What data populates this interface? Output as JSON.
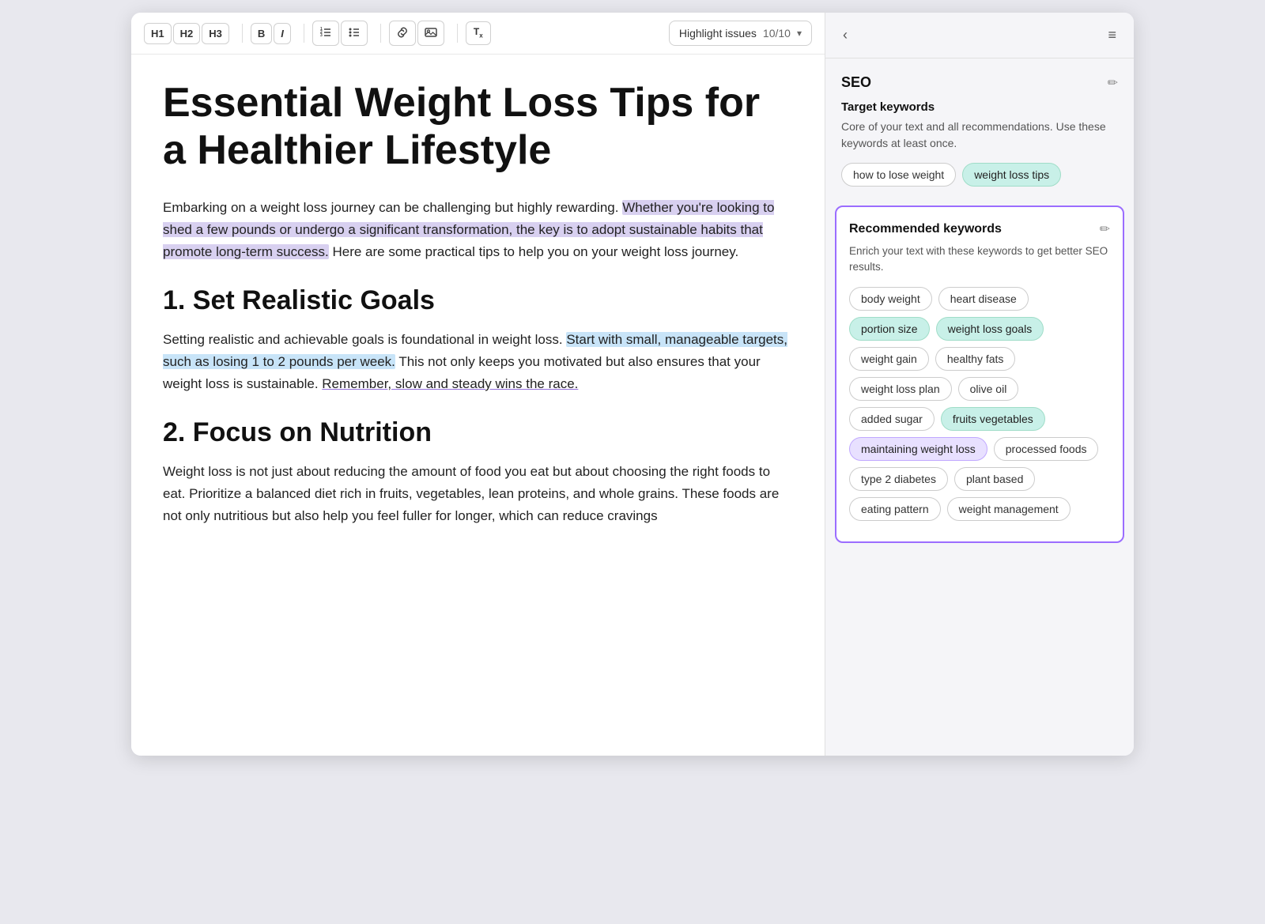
{
  "toolbar": {
    "h1_label": "H1",
    "h2_label": "H2",
    "h3_label": "H3",
    "bold_label": "B",
    "italic_label": "I",
    "highlight_label": "Highlight issues",
    "highlight_count": "10/10"
  },
  "editor": {
    "title": "Essential Weight Loss Tips for a Healthier Lifestyle",
    "paragraph1_plain": "Embarking on a weight loss journey can be challenging but highly rewarding. ",
    "paragraph1_highlight": "Whether you're looking to shed a few pounds or undergo a significant transformation, the key is to adopt sustainable habits that promote long-term success.",
    "paragraph1_end": " Here are some practical tips to help you on your weight loss journey.",
    "heading1": "1. Set Realistic Goals",
    "paragraph2_plain": "Setting realistic and achievable goals is foundational in weight loss. ",
    "paragraph2_highlight": "Start with small, manageable targets, such as losing 1 to 2 pounds per week.",
    "paragraph2_mid": " This not only keeps you motivated but also ensures that your weight loss is sustainable. ",
    "paragraph2_underline": "Remember, slow and steady wins the race.",
    "heading2": "2. Focus on Nutrition",
    "paragraph3": "Weight loss is not just about reducing the amount of food you eat but about choosing the right foods to eat. Prioritize a balanced diet rich in fruits, vegetables, lean proteins, and whole grains. These foods are not only nutritious but also help you feel fuller for longer, which can reduce cravings"
  },
  "seo_panel": {
    "title": "SEO",
    "back_icon": "‹",
    "menu_icon": "≡",
    "edit_icon": "✏",
    "target_keywords": {
      "label": "Target keywords",
      "description": "Core of your text and all recommendations. Use these keywords at least once.",
      "keywords": [
        {
          "text": "how to lose weight",
          "style": "default"
        },
        {
          "text": "weight loss tips",
          "style": "active-teal"
        }
      ]
    },
    "recommended_keywords": {
      "label": "Recommended keywords",
      "description": "Enrich your text with these keywords to get better SEO results.",
      "keywords": [
        {
          "text": "body weight",
          "style": "default"
        },
        {
          "text": "heart disease",
          "style": "default"
        },
        {
          "text": "portion size",
          "style": "active-teal"
        },
        {
          "text": "weight loss goals",
          "style": "active-teal"
        },
        {
          "text": "weight gain",
          "style": "default"
        },
        {
          "text": "healthy fats",
          "style": "default"
        },
        {
          "text": "weight loss plan",
          "style": "default"
        },
        {
          "text": "olive oil",
          "style": "default"
        },
        {
          "text": "added sugar",
          "style": "default"
        },
        {
          "text": "fruits vegetables",
          "style": "active-teal"
        },
        {
          "text": "maintaining weight loss",
          "style": "active-purple"
        },
        {
          "text": "processed foods",
          "style": "default"
        },
        {
          "text": "type 2 diabetes",
          "style": "default"
        },
        {
          "text": "plant based",
          "style": "default"
        },
        {
          "text": "eating pattern",
          "style": "default"
        },
        {
          "text": "weight management",
          "style": "default"
        }
      ]
    }
  }
}
